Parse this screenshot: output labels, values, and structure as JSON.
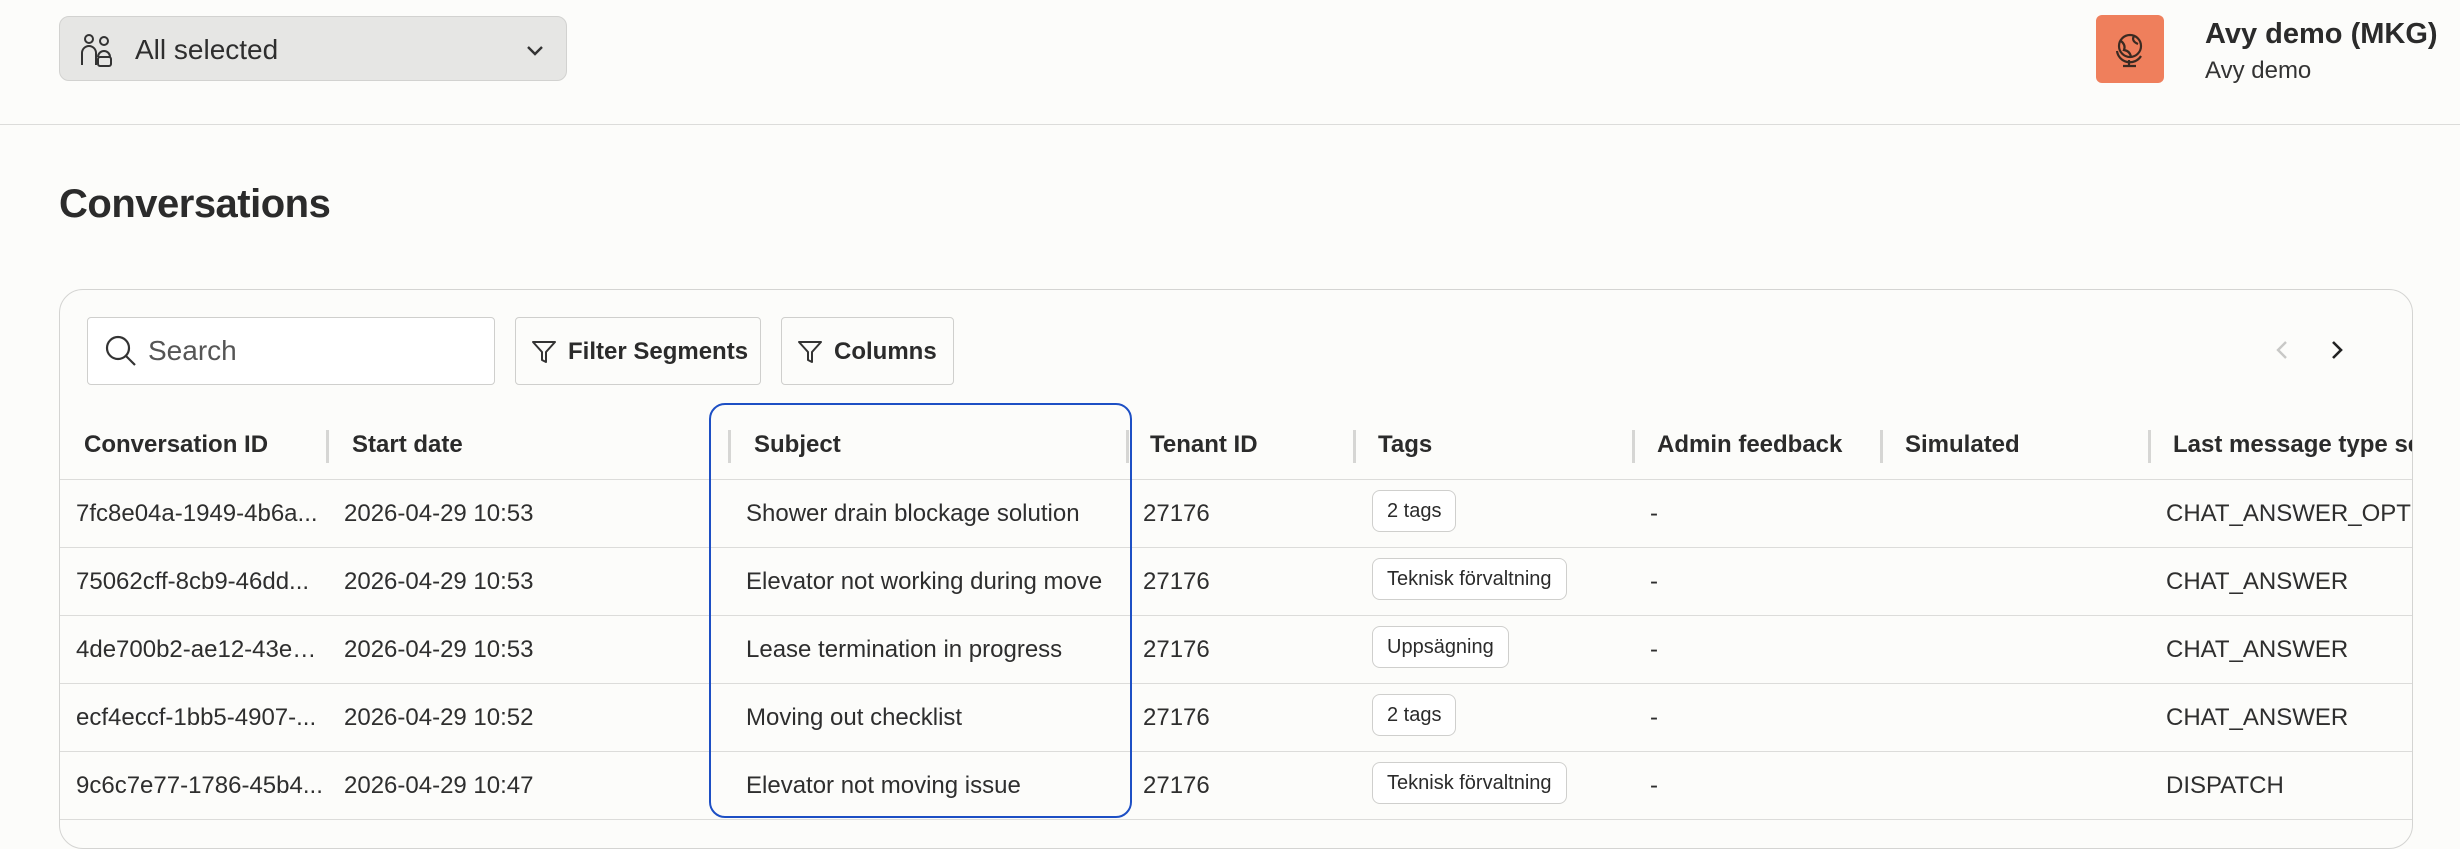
{
  "header": {
    "segment_select": {
      "value": "All selected",
      "icon": "people-group-icon"
    },
    "org": {
      "name": "Avy demo (MKG)",
      "subtitle": "Avy demo",
      "logo_color": "#ef7f5c"
    }
  },
  "page": {
    "title": "Conversations"
  },
  "toolbar": {
    "search_placeholder": "Search",
    "filter_label": "Filter Segments",
    "columns_label": "Columns"
  },
  "table": {
    "columns": [
      "Conversation ID",
      "Start date",
      "Subject",
      "Tenant ID",
      "Tags",
      "Admin feedback",
      "Simulated",
      "Last message type se"
    ],
    "rows": [
      {
        "id": "7fc8e04a-1949-4b6a...",
        "start": "2026-04-29 10:53",
        "subject": "Shower drain blockage solution",
        "tenant": "27176",
        "tag": "2 tags",
        "feedback": "-",
        "simulated": "",
        "last_type": "CHAT_ANSWER_OPTIO"
      },
      {
        "id": "75062cff-8cb9-46dd...",
        "start": "2026-04-29 10:53",
        "subject": "Elevator not working during move",
        "tenant": "27176",
        "tag": "Teknisk förvaltning",
        "feedback": "-",
        "simulated": "",
        "last_type": "CHAT_ANSWER"
      },
      {
        "id": "4de700b2-ae12-43e1...",
        "start": "2026-04-29 10:53",
        "subject": "Lease termination in progress",
        "tenant": "27176",
        "tag": "Uppsägning",
        "feedback": "-",
        "simulated": "",
        "last_type": "CHAT_ANSWER"
      },
      {
        "id": "ecf4eccf-1bb5-4907-...",
        "start": "2026-04-29 10:52",
        "subject": "Moving out checklist",
        "tenant": "27176",
        "tag": "2 tags",
        "feedback": "-",
        "simulated": "",
        "last_type": "CHAT_ANSWER"
      },
      {
        "id": "9c6c7e77-1786-45b4...",
        "start": "2026-04-29 10:47",
        "subject": "Elevator not moving issue",
        "tenant": "27176",
        "tag": "Teknisk förvaltning",
        "feedback": "-",
        "simulated": "",
        "last_type": "DISPATCH"
      }
    ]
  },
  "colors": {
    "accent": "#1d4fc4",
    "background": "#fcfcfa",
    "brand": "#ef7f5c"
  }
}
